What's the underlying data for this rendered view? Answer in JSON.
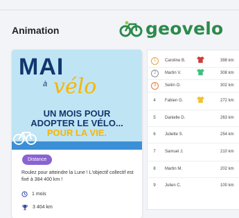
{
  "header": {
    "title": "Animation",
    "brand": "geovelo"
  },
  "poster": {
    "line1": "MAI",
    "line2": "à",
    "line3": "vélo",
    "tag1": "UN MOIS POUR",
    "tag2": "ADOPTER LE VÉLO...",
    "tag3": "POUR LA VIE."
  },
  "card": {
    "badge": "Distance",
    "description": "Roulez pour atteindre la Lune ! L'objectif collectif est fixé à 384 400 km !",
    "duration": "1 mois",
    "total": "3 404 km"
  },
  "leaderboard": [
    {
      "rank": "1",
      "name": "Caroline B.",
      "jersey": "red",
      "distance": "398 km"
    },
    {
      "rank": "2",
      "name": "Martin V.",
      "jersey": "green",
      "distance": "308 km"
    },
    {
      "rank": "3",
      "name": "Selim O.",
      "jersey": "",
      "distance": "302 km"
    },
    {
      "rank": "4",
      "name": "Fabien G.",
      "jersey": "yellow",
      "distance": "272 km"
    },
    {
      "rank": "5",
      "name": "Danielle D.",
      "jersey": "",
      "distance": "263 km"
    },
    {
      "rank": "6",
      "name": "Juliette S.",
      "jersey": "",
      "distance": "254 km"
    },
    {
      "rank": "7",
      "name": "Samuel J.",
      "jersey": "",
      "distance": "210 km"
    },
    {
      "rank": "8",
      "name": "Martin M.",
      "jersey": "",
      "distance": "202 km"
    },
    {
      "rank": "9",
      "name": "Julien C.",
      "jersey": "",
      "distance": "100 km"
    }
  ],
  "colors": {
    "brand": "#2c8a4b",
    "badge": "#8a63d2",
    "gold": "#e8a33a",
    "silver": "#8a8f98",
    "bronze": "#e07a3a"
  }
}
